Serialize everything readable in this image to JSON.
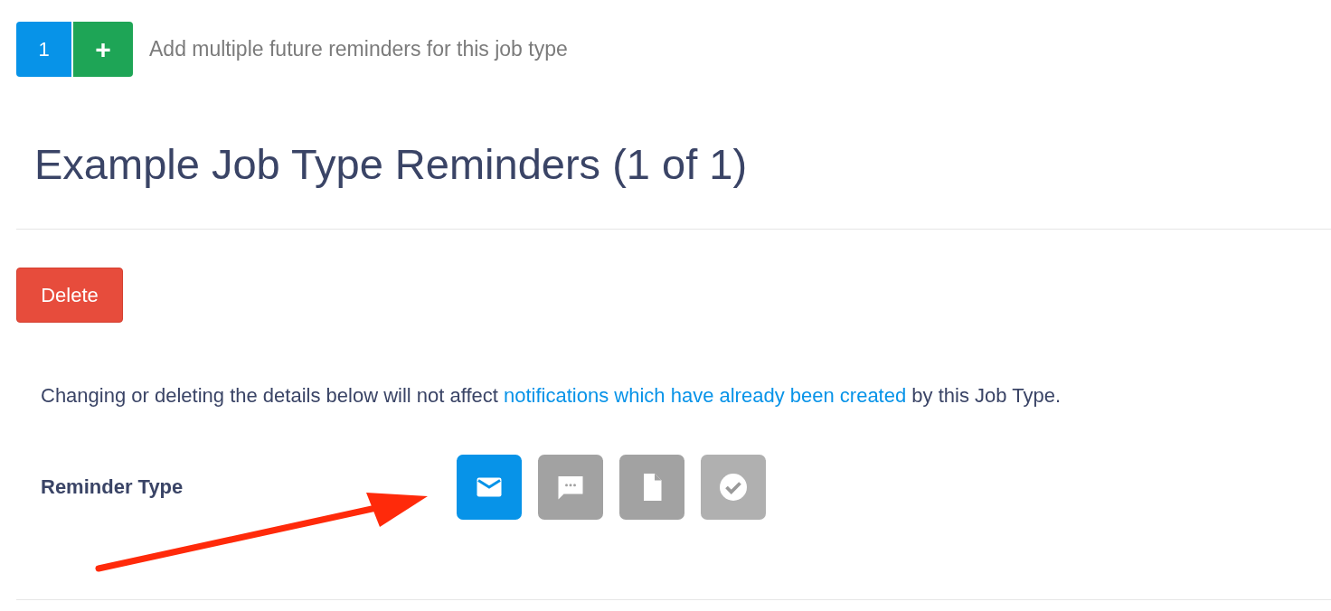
{
  "reminder_count": {
    "count": "1",
    "add_label": "+",
    "hint": "Add multiple future reminders for this job type"
  },
  "title": "Example Job Type Reminders (1 of 1)",
  "delete_button": "Delete",
  "notice": {
    "before": "Changing or deleting the details below will not affect ",
    "link": "notifications which have already been created",
    "after": " by this Job Type."
  },
  "reminder_type": {
    "label": "Reminder Type",
    "options": [
      {
        "kind": "email",
        "selected": true,
        "disabled": false
      },
      {
        "kind": "sms",
        "selected": false,
        "disabled": false
      },
      {
        "kind": "document",
        "selected": false,
        "disabled": false
      },
      {
        "kind": "check",
        "selected": false,
        "disabled": true
      }
    ]
  }
}
